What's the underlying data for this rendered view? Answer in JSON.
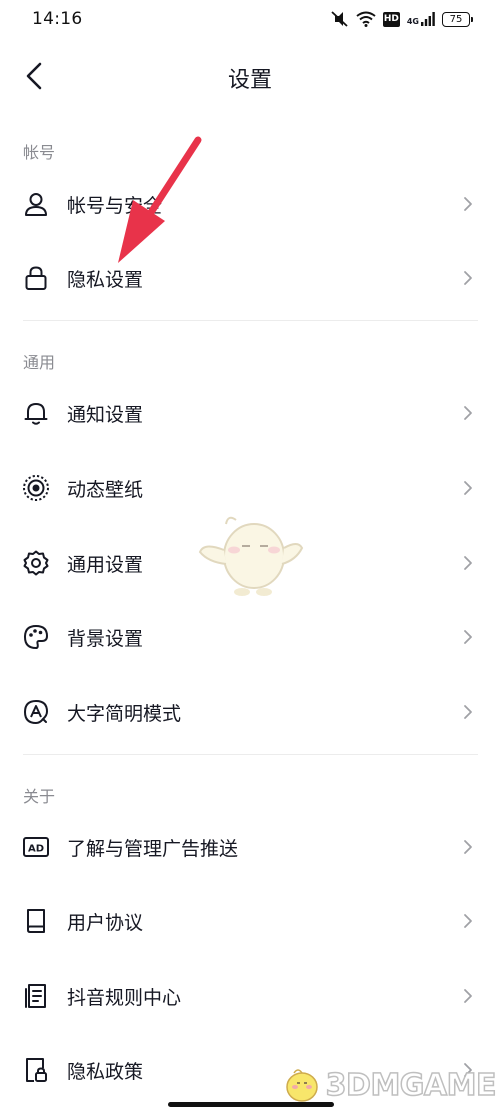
{
  "status_bar": {
    "time": "14:16",
    "hd": "HD",
    "network": "4G",
    "battery": "75"
  },
  "nav": {
    "title": "设置"
  },
  "sections": [
    {
      "header": "帐号",
      "items": [
        {
          "label": "帐号与安全",
          "icon": "person-icon"
        },
        {
          "label": "隐私设置",
          "icon": "lock-icon"
        }
      ]
    },
    {
      "header": "通用",
      "items": [
        {
          "label": "通知设置",
          "icon": "bell-icon"
        },
        {
          "label": "动态壁纸",
          "icon": "live-wallpaper-icon"
        },
        {
          "label": "通用设置",
          "icon": "gear-icon"
        },
        {
          "label": "背景设置",
          "icon": "palette-icon"
        },
        {
          "label": "大字简明模式",
          "icon": "large-font-icon"
        }
      ]
    },
    {
      "header": "关于",
      "items": [
        {
          "label": "了解与管理广告推送",
          "icon": "ad-icon"
        },
        {
          "label": "用户协议",
          "icon": "book-icon"
        },
        {
          "label": "抖音规则中心",
          "icon": "rules-document-icon"
        },
        {
          "label": "隐私政策",
          "icon": "privacy-policy-icon"
        }
      ]
    }
  ],
  "watermark": {
    "text": "3DMGAME"
  },
  "colors": {
    "annotation_arrow": "#e8334a",
    "text_primary": "#161823",
    "text_secondary": "#8a8b91",
    "chevron": "#a0a1a6"
  }
}
